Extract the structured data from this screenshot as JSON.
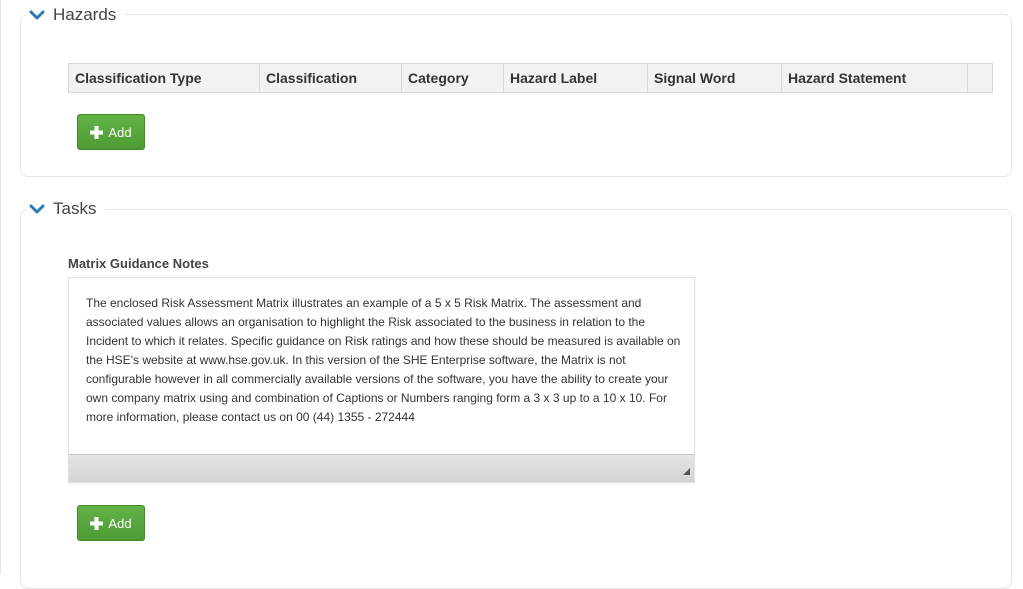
{
  "hazards": {
    "title": "Hazards",
    "columns": [
      "Classification Type",
      "Classification",
      "Category",
      "Hazard Label",
      "Signal Word",
      "Hazard Statement"
    ],
    "add_label": "Add"
  },
  "tasks": {
    "title": "Tasks",
    "notes_label": "Matrix Guidance Notes",
    "notes_text": "The enclosed Risk Assessment Matrix illustrates an example of a 5 x 5 Risk Matrix. The assessment and associated values allows an organisation to highlight the Risk associated to the business in relation to the Incident to which it relates. Specific guidance on Risk ratings and how these should be measured is available on the HSE's website at www.hse.gov.uk. In this version of the SHE Enterprise software, the Matrix is not configurable however in all commercially available versions of the software, you have the ability to create your own company matrix using and combination of Captions or Numbers ranging form a 3 x 3 up to a 10 x 10. For more information, please contact us on 00 (44) 1355 - 272444",
    "add_label": "Add"
  },
  "icons": {
    "collapse": "chevron-down-icon",
    "add": "plus-icon",
    "resize": "resize-grip-icon"
  },
  "colors": {
    "accent": "#2a7ab8",
    "button_green": "#5aa83e"
  }
}
